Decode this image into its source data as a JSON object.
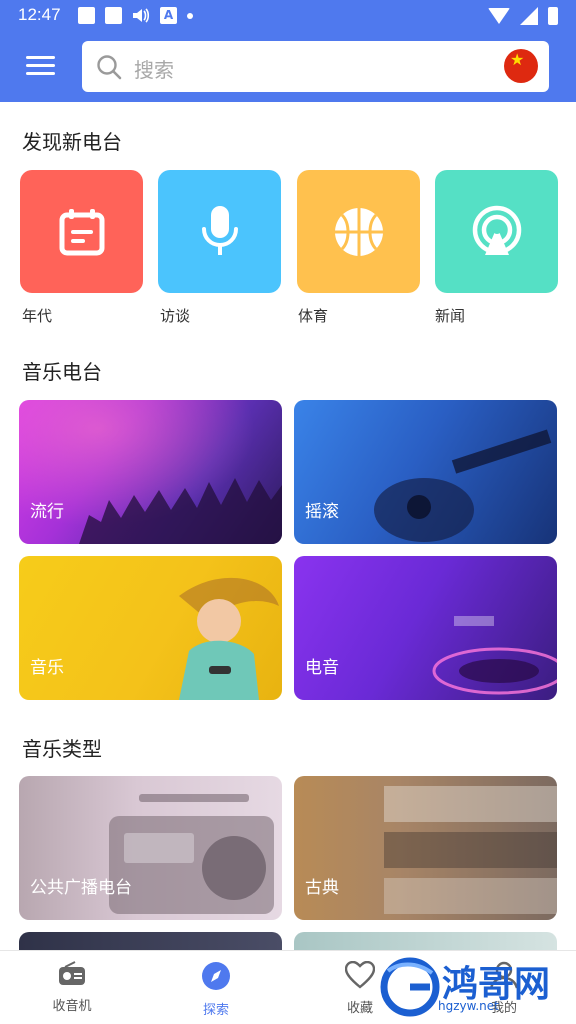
{
  "status_bar": {
    "time": "12:47",
    "text_icon_letter": "A"
  },
  "header": {
    "search_placeholder": "搜索",
    "flag": "china-flag"
  },
  "discover": {
    "title": "发现新电台",
    "items": [
      {
        "label": "年代",
        "icon": "calendar-icon",
        "color": "#ff6359"
      },
      {
        "label": "访谈",
        "icon": "microphone-icon",
        "color": "#4bc4fd"
      },
      {
        "label": "体育",
        "icon": "basketball-icon",
        "color": "#ffc14e"
      },
      {
        "label": "新闻",
        "icon": "broadcast-icon",
        "color": "#55e0c5"
      }
    ]
  },
  "music_radio": {
    "title": "音乐电台",
    "items": [
      {
        "label": "流行"
      },
      {
        "label": "摇滚"
      },
      {
        "label": "音乐"
      },
      {
        "label": "电音"
      }
    ]
  },
  "music_types": {
    "title": "音乐类型",
    "items": [
      {
        "label": "公共广播电台"
      },
      {
        "label": "古典"
      }
    ]
  },
  "bottom_nav": {
    "items": [
      {
        "label": "收音机",
        "icon": "radio-icon",
        "active": false
      },
      {
        "label": "探索",
        "icon": "compass-icon",
        "active": true
      },
      {
        "label": "收藏",
        "icon": "heart-icon",
        "active": false
      },
      {
        "label": "我的",
        "icon": "user-icon",
        "active": false
      }
    ]
  },
  "watermark": {
    "text": "鸿哥网",
    "url": "hgzyw.net"
  }
}
